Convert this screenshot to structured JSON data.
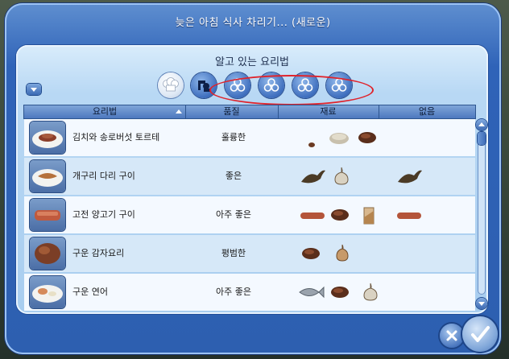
{
  "window": {
    "title": "늦은 아침 식사 차리기... (새로운)"
  },
  "panel": {
    "subtitle": "알고 있는 요리법"
  },
  "filters": [
    {
      "icon": "chef-hat-icon",
      "active": true
    },
    {
      "icon": "serving-hand-icon",
      "active": false
    },
    {
      "icon": "ingredient-circles-icon",
      "active": false
    },
    {
      "icon": "ingredient-circles-icon",
      "active": false
    },
    {
      "icon": "ingredient-circles-icon",
      "active": false
    },
    {
      "icon": "ingredient-circles-icon",
      "active": false
    }
  ],
  "table": {
    "headers": [
      "요리법",
      "품질",
      "재료",
      "없음"
    ],
    "rows": [
      {
        "name": "김치와 송로버섯 토르테",
        "quality": "훌륭한",
        "ingredients": [
          "truffle",
          "cheese",
          "potato"
        ],
        "missing": []
      },
      {
        "name": "개구리 다리 구이",
        "quality": "좋은",
        "ingredients": [
          "frog",
          "garlic"
        ],
        "missing": [
          "frog"
        ]
      },
      {
        "name": "고전 양고기 구이",
        "quality": "아주 좋은",
        "ingredients": [
          "sausage",
          "potato",
          "tofu"
        ],
        "missing": [
          "sausage"
        ]
      },
      {
        "name": "구운 감자요리",
        "quality": "평범한",
        "ingredients": [
          "potato",
          "onion"
        ],
        "missing": []
      },
      {
        "name": "구운 연어",
        "quality": "아주 좋은",
        "ingredients": [
          "fish",
          "potato",
          "garlic"
        ],
        "missing": []
      }
    ]
  },
  "colors": {
    "window_blue": "#2f63b8",
    "panel_light": "#b8d8f4",
    "highlight_red": "#e0232b"
  }
}
